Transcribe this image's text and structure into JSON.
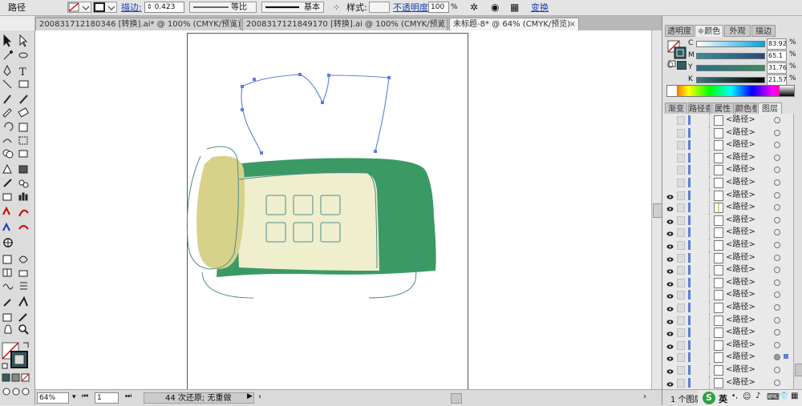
{
  "control_bar": {
    "object_type": "路径",
    "stroke_label": "描边:",
    "stroke_value": "0.423",
    "profile_label": "等比",
    "brush_label": "基本",
    "style_label": "样式:",
    "opacity_label": "不透明度:",
    "opacity_value": "100",
    "percent": "%",
    "transform_label": "变换"
  },
  "tabs": [
    {
      "label": "200831712180346 [转换].ai* @ 100% (CMYK/预览)",
      "close": "×"
    },
    {
      "label": "200831712184917​0 [转换].ai @ 100% (CMYK/预览)",
      "close": "×"
    },
    {
      "label": "未标题-8* @ 64% (CMYK/预览)",
      "close": "×"
    }
  ],
  "status_bar": {
    "zoom": "64%",
    "artboard": "1",
    "history": "44 次还原; 无重做"
  },
  "color_panel": {
    "tabs": [
      "透明度",
      "颜色",
      "外观",
      "描边"
    ],
    "active": "颜色",
    "channels": [
      {
        "name": "C",
        "value": "83.92",
        "pct": "%"
      },
      {
        "name": "M",
        "value": "65.1",
        "pct": "%"
      },
      {
        "name": "Y",
        "value": "31.76",
        "pct": "%"
      },
      {
        "name": "K",
        "value": "21.57",
        "pct": "%"
      }
    ],
    "fill_color": "#2f5d62"
  },
  "layers_panel": {
    "tabs": [
      "渐变",
      "路径查",
      "属性",
      "颜色参",
      "图层"
    ],
    "active": "图层",
    "item_name": "<路径>",
    "rows_count": 22,
    "footer": "1 个图层"
  },
  "taskbar": {
    "ime": "英"
  },
  "colors": {
    "sofa_green": "#3b9a64",
    "cushion_cream": "#efefce",
    "arm_yellow": "#d6d28a",
    "outline_teal": "#4d8c8f",
    "path_blue": "#5a7fd8"
  }
}
